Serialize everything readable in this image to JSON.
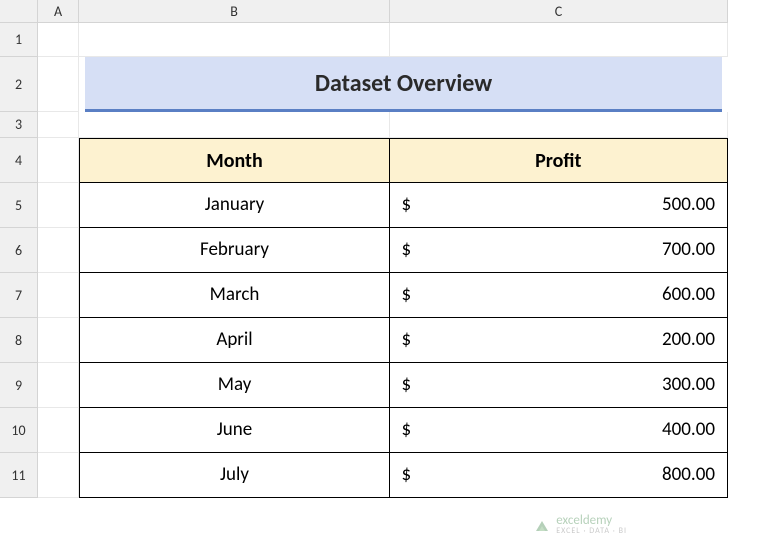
{
  "columns": [
    "A",
    "B",
    "C"
  ],
  "rows": [
    "1",
    "2",
    "3",
    "4",
    "5",
    "6",
    "7",
    "8",
    "9",
    "10",
    "11"
  ],
  "title": "Dataset Overview",
  "headers": {
    "month": "Month",
    "profit": "Profit"
  },
  "currency_symbol": "$",
  "data": [
    {
      "month": "January",
      "profit": "500.00"
    },
    {
      "month": "February",
      "profit": "700.00"
    },
    {
      "month": "March",
      "profit": "600.00"
    },
    {
      "month": "April",
      "profit": "200.00"
    },
    {
      "month": "May",
      "profit": "300.00"
    },
    {
      "month": "June",
      "profit": "400.00"
    },
    {
      "month": "July",
      "profit": "800.00"
    }
  ],
  "watermark": {
    "brand": "exceldemy",
    "tagline": "EXCEL · DATA · BI"
  },
  "chart_data": {
    "type": "table",
    "title": "Dataset Overview",
    "columns": [
      "Month",
      "Profit"
    ],
    "categories": [
      "January",
      "February",
      "March",
      "April",
      "May",
      "June",
      "July"
    ],
    "values": [
      500.0,
      700.0,
      600.0,
      200.0,
      300.0,
      400.0,
      800.0
    ],
    "xlabel": "Month",
    "ylabel": "Profit",
    "ylim": [
      0,
      800
    ]
  }
}
